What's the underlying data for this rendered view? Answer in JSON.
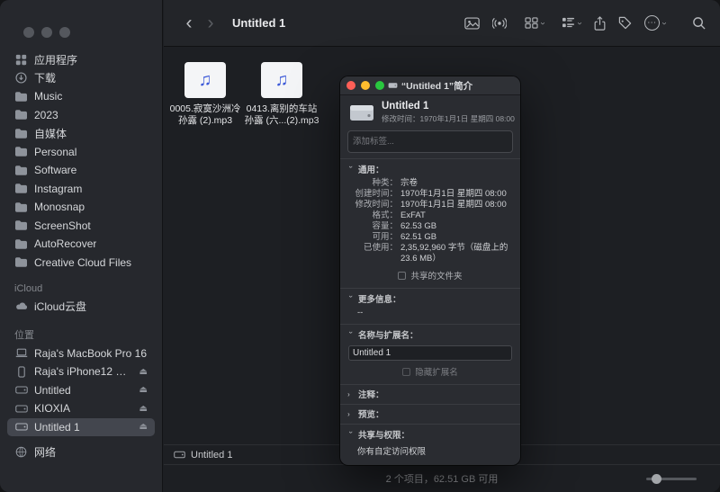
{
  "icons": {
    "back": "‹",
    "forward": "›",
    "disclosure": "›",
    "eject": "⏏",
    "ellipsis": "⋯",
    "note": "♫"
  },
  "toolbar": {
    "title": "Untitled 1"
  },
  "sidebar": {
    "favorites": [
      {
        "label": "应用程序"
      },
      {
        "label": "下载"
      },
      {
        "label": "Music"
      },
      {
        "label": "2023"
      },
      {
        "label": "自媒体"
      },
      {
        "label": "Personal"
      },
      {
        "label": "Software"
      },
      {
        "label": "Instagram"
      },
      {
        "label": "Monosnap"
      },
      {
        "label": "ScreenShot"
      },
      {
        "label": "AutoRecover"
      },
      {
        "label": "Creative Cloud Files"
      }
    ],
    "icloud_header": "iCloud",
    "icloud": [
      {
        "label": "iCloud云盘"
      }
    ],
    "locations_header": "位置",
    "locations": [
      {
        "label": "Raja's MacBook Pro 16"
      },
      {
        "label": "Raja's iPhone12 P..."
      },
      {
        "label": "Untitled"
      },
      {
        "label": "KIOXIA"
      },
      {
        "label": "Untitled 1"
      },
      {
        "label": "网络"
      }
    ]
  },
  "files": [
    {
      "line1": "0005.寂寞沙洲冷",
      "line2": "孙露 (2).mp3"
    },
    {
      "line1": "0413.离别的车站",
      "line2": "孙露 (六...(2).mp3"
    }
  ],
  "info": {
    "title": "“Untitled 1”简介",
    "name": "Untitled 1",
    "modified": "修改时间：1970年1月1日 星期四 08:00",
    "tags_placeholder": "添加标签...",
    "general_header": "通用：",
    "general_rows": [
      {
        "label": "种类：",
        "value": "宗卷"
      },
      {
        "label": "创建时间：",
        "value": "1970年1月1日 星期四 08:00"
      },
      {
        "label": "修改时间：",
        "value": "1970年1月1日 星期四 08:00"
      },
      {
        "label": "格式：",
        "value": "ExFAT"
      },
      {
        "label": "容量：",
        "value": "62.53 GB"
      },
      {
        "label": "可用：",
        "value": "62.51 GB"
      },
      {
        "label": "已使用：",
        "value": "2,35,92,960 字节（磁盘上的 23.6 MB）"
      }
    ],
    "shared_folder": "共享的文件夹",
    "more_info_header": "更多信息：",
    "more_info_value": "--",
    "name_ext_header": "名称与扩展名：",
    "name_value": "Untitled 1",
    "hide_ext": "隐藏扩展名",
    "comments_header": "注释：",
    "preview_header": "预览：",
    "sharing_header": "共享与权限：",
    "sharing_value": "你有自定访问权限"
  },
  "pathbar": {
    "item": "Untitled 1"
  },
  "statusbar": {
    "text": "2 个项目，62.51 GB 可用"
  }
}
